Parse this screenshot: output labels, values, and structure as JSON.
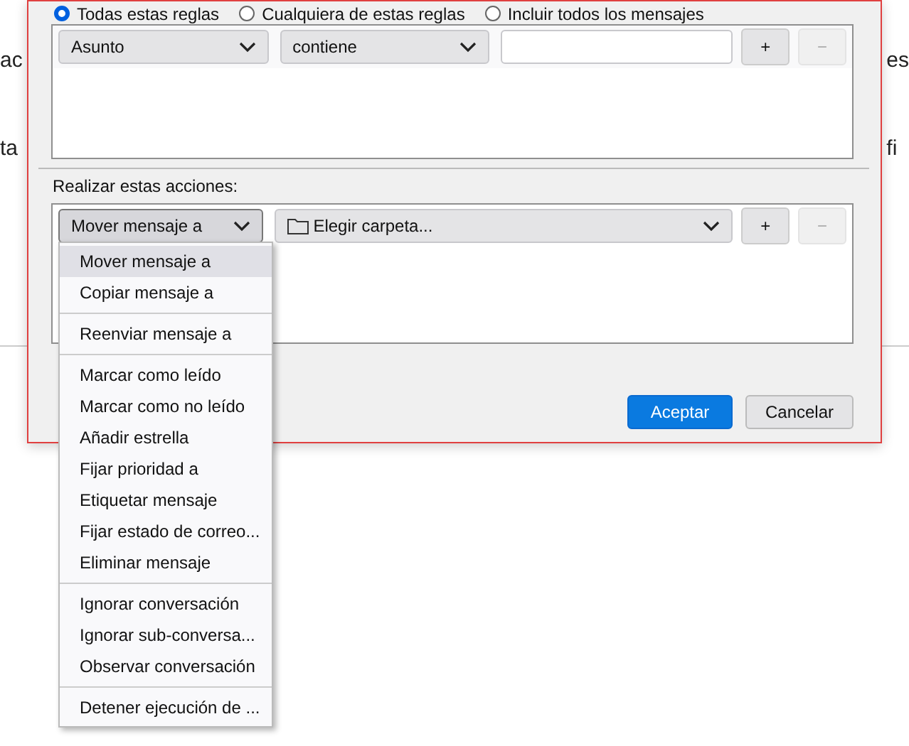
{
  "background_window": {
    "left_fragments": [
      "ac",
      "ta"
    ],
    "right_fragments": [
      "es",
      "fi"
    ]
  },
  "match_options": [
    {
      "label": "Todas estas reglas",
      "selected": true
    },
    {
      "label": "Cualquiera de estas reglas",
      "selected": false
    },
    {
      "label": "Incluir todos los mensajes",
      "selected": false
    }
  ],
  "rules": [
    {
      "field": "Asunto",
      "operator": "contiene",
      "add": "+",
      "remove": "−",
      "remove_disabled": true
    }
  ],
  "actions_label": "Realizar estas acciones:",
  "actions": [
    {
      "action": "Mover mensaje a",
      "expanded": true,
      "target": "Elegir carpeta...",
      "add": "+",
      "remove": "−",
      "remove_disabled": true
    }
  ],
  "action_menu": {
    "groups": [
      [
        {
          "label": "Mover mensaje a",
          "selected": true
        },
        {
          "label": "Copiar mensaje a",
          "selected": false
        }
      ],
      [
        {
          "label": "Reenviar mensaje a",
          "selected": false
        }
      ],
      [
        {
          "label": "Marcar como leído",
          "selected": false
        },
        {
          "label": "Marcar como no leído",
          "selected": false
        },
        {
          "label": "Añadir estrella",
          "selected": false
        },
        {
          "label": "Fijar prioridad a",
          "selected": false
        },
        {
          "label": "Etiquetar mensaje",
          "selected": false
        },
        {
          "label": "Fijar estado de correo...",
          "selected": false
        },
        {
          "label": "Eliminar mensaje",
          "selected": false
        }
      ],
      [
        {
          "label": "Ignorar conversación",
          "selected": false
        },
        {
          "label": "Ignorar sub-conversa...",
          "selected": false
        },
        {
          "label": "Observar conversación",
          "selected": false
        }
      ],
      [
        {
          "label": "Detener ejecución de ...",
          "selected": false
        }
      ]
    ]
  },
  "buttons": [
    {
      "label": "Aceptar",
      "kind": "primary"
    },
    {
      "label": "Cancelar",
      "kind": "secondary"
    }
  ]
}
